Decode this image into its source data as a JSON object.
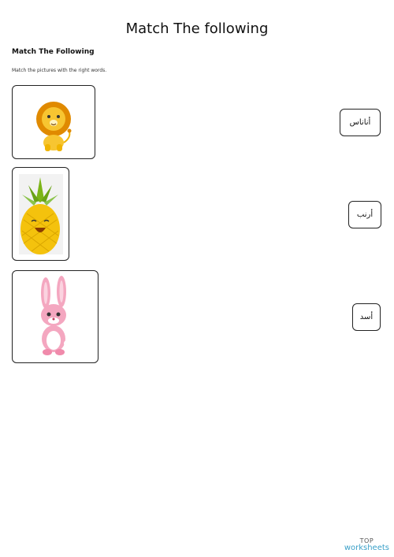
{
  "worksheet": {
    "title": "Match The following",
    "subtitle": "Match The Following",
    "instructions": "Match the pictures with the right words."
  },
  "pictures": [
    {
      "subject": "lion",
      "icon": "lion-icon"
    },
    {
      "subject": "pineapple",
      "icon": "pineapple-icon"
    },
    {
      "subject": "rabbit",
      "icon": "rabbit-icon"
    }
  ],
  "words": [
    "أناناس",
    "أرنب",
    "أسد"
  ],
  "brand": {
    "top": "TOP",
    "name": "worksheets"
  },
  "colors": {
    "brand_blue": "#3aa0c8",
    "lion": "#f5b400",
    "pineapple": "#f4c20d",
    "leaves": "#7cb518",
    "rabbit": "#f4a7c0"
  }
}
